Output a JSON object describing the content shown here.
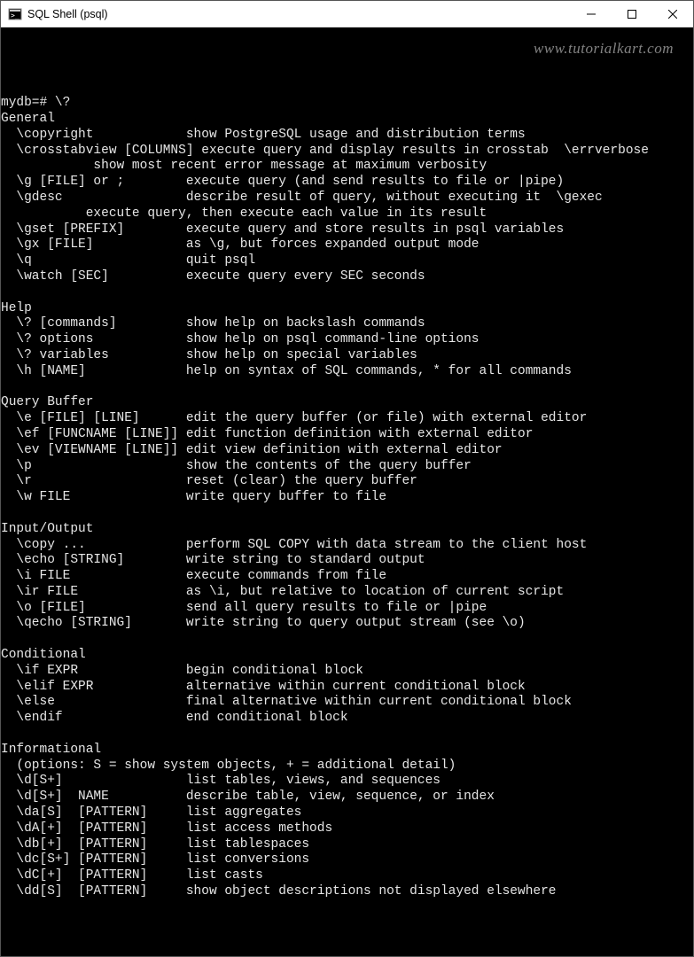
{
  "window": {
    "title": "SQL Shell (psql)"
  },
  "watermark": "www.tutorialkart.com",
  "prompt": "mydb=# \\?",
  "sections": [
    {
      "title": "General",
      "items": [
        {
          "cmd": "  \\copyright            ",
          "desc": "show PostgreSQL usage and distribution terms"
        },
        {
          "cmd": "  \\crosstabview [COLUMNS] ",
          "desc": "execute query and display results in crosstab  \\errverbose"
        },
        {
          "cmd": "            ",
          "desc": "show most recent error message at maximum verbosity"
        },
        {
          "cmd": "  \\g [FILE] or ;        ",
          "desc": "execute query (and send results to file or |pipe)"
        },
        {
          "cmd": "  \\gdesc                ",
          "desc": "describe result of query, without executing it  \\gexec"
        },
        {
          "cmd": "           ",
          "desc": "execute query, then execute each value in its result"
        },
        {
          "cmd": "  \\gset [PREFIX]        ",
          "desc": "execute query and store results in psql variables"
        },
        {
          "cmd": "  \\gx [FILE]            ",
          "desc": "as \\g, but forces expanded output mode"
        },
        {
          "cmd": "  \\q                    ",
          "desc": "quit psql"
        },
        {
          "cmd": "  \\watch [SEC]          ",
          "desc": "execute query every SEC seconds"
        }
      ]
    },
    {
      "title": "Help",
      "items": [
        {
          "cmd": "  \\? [commands]         ",
          "desc": "show help on backslash commands"
        },
        {
          "cmd": "  \\? options            ",
          "desc": "show help on psql command-line options"
        },
        {
          "cmd": "  \\? variables          ",
          "desc": "show help on special variables"
        },
        {
          "cmd": "  \\h [NAME]             ",
          "desc": "help on syntax of SQL commands, * for all commands"
        }
      ]
    },
    {
      "title": "Query Buffer",
      "items": [
        {
          "cmd": "  \\e [FILE] [LINE]      ",
          "desc": "edit the query buffer (or file) with external editor"
        },
        {
          "cmd": "  \\ef [FUNCNAME [LINE]] ",
          "desc": "edit function definition with external editor"
        },
        {
          "cmd": "  \\ev [VIEWNAME [LINE]] ",
          "desc": "edit view definition with external editor"
        },
        {
          "cmd": "  \\p                    ",
          "desc": "show the contents of the query buffer"
        },
        {
          "cmd": "  \\r                    ",
          "desc": "reset (clear) the query buffer"
        },
        {
          "cmd": "  \\w FILE               ",
          "desc": "write query buffer to file"
        }
      ]
    },
    {
      "title": "Input/Output",
      "items": [
        {
          "cmd": "  \\copy ...             ",
          "desc": "perform SQL COPY with data stream to the client host"
        },
        {
          "cmd": "  \\echo [STRING]        ",
          "desc": "write string to standard output"
        },
        {
          "cmd": "  \\i FILE               ",
          "desc": "execute commands from file"
        },
        {
          "cmd": "  \\ir FILE              ",
          "desc": "as \\i, but relative to location of current script"
        },
        {
          "cmd": "  \\o [FILE]             ",
          "desc": "send all query results to file or |pipe"
        },
        {
          "cmd": "  \\qecho [STRING]       ",
          "desc": "write string to query output stream (see \\o)"
        }
      ]
    },
    {
      "title": "Conditional",
      "items": [
        {
          "cmd": "  \\if EXPR              ",
          "desc": "begin conditional block"
        },
        {
          "cmd": "  \\elif EXPR            ",
          "desc": "alternative within current conditional block"
        },
        {
          "cmd": "  \\else                 ",
          "desc": "final alternative within current conditional block"
        },
        {
          "cmd": "  \\endif                ",
          "desc": "end conditional block"
        }
      ]
    },
    {
      "title": "Informational",
      "note": "  (options: S = show system objects, + = additional detail)",
      "items": [
        {
          "cmd": "  \\d[S+]                ",
          "desc": "list tables, views, and sequences"
        },
        {
          "cmd": "  \\d[S+]  NAME          ",
          "desc": "describe table, view, sequence, or index"
        },
        {
          "cmd": "  \\da[S]  [PATTERN]     ",
          "desc": "list aggregates"
        },
        {
          "cmd": "  \\dA[+]  [PATTERN]     ",
          "desc": "list access methods"
        },
        {
          "cmd": "  \\db[+]  [PATTERN]     ",
          "desc": "list tablespaces"
        },
        {
          "cmd": "  \\dc[S+] [PATTERN]     ",
          "desc": "list conversions"
        },
        {
          "cmd": "  \\dC[+]  [PATTERN]     ",
          "desc": "list casts"
        },
        {
          "cmd": "  \\dd[S]  [PATTERN]     ",
          "desc": "show object descriptions not displayed elsewhere"
        }
      ]
    }
  ]
}
